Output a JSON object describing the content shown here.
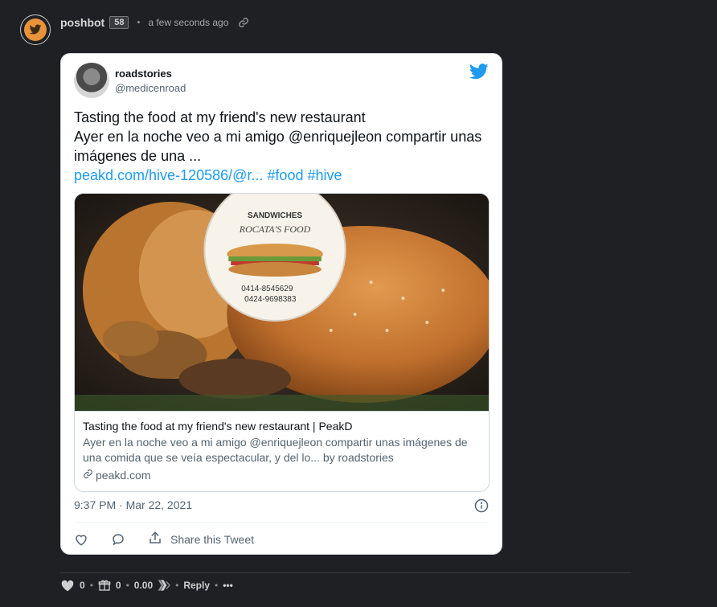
{
  "post": {
    "author": "poshbot",
    "reputation": "58",
    "separator": "•",
    "time": "a few seconds ago"
  },
  "tweet": {
    "name": "roadstories",
    "handle": "@medicenroad",
    "line1": "Tasting the food at my friend's new restaurant",
    "line2": "Ayer en la noche veo a mi amigo @enriquejleon compartir unas imágenes de una ...",
    "link_url": "peakd.com/hive-120586/@r...",
    "hashtag_food": "#food",
    "hashtag_hive": "#hive",
    "preview": {
      "title": "Tasting the food at my friend's new restaurant | PeakD",
      "description": "Ayer en la noche veo a mi amigo @enriquejleon compartir unas imágenes de una comida que se veía espectacular, y del lo... by roadstories",
      "domain": "peakd.com",
      "image_sticker_brand": "SANDWICHES",
      "image_sticker_name": "ROCATA'S FOOD",
      "image_phone1": "0414-8545629",
      "image_phone2": "0424-9698383"
    },
    "date": "9:37 PM · Mar 22, 2021",
    "share_label": "Share this Tweet"
  },
  "footer": {
    "votes": "0",
    "sep": "•",
    "gifts": "0",
    "payout": "0.00",
    "reply": "Reply",
    "more": "•••"
  },
  "colors": {
    "twitter_blue": "#1d9bf0",
    "avatar_orange": "#e8923a",
    "page_bg": "#1f2024"
  }
}
